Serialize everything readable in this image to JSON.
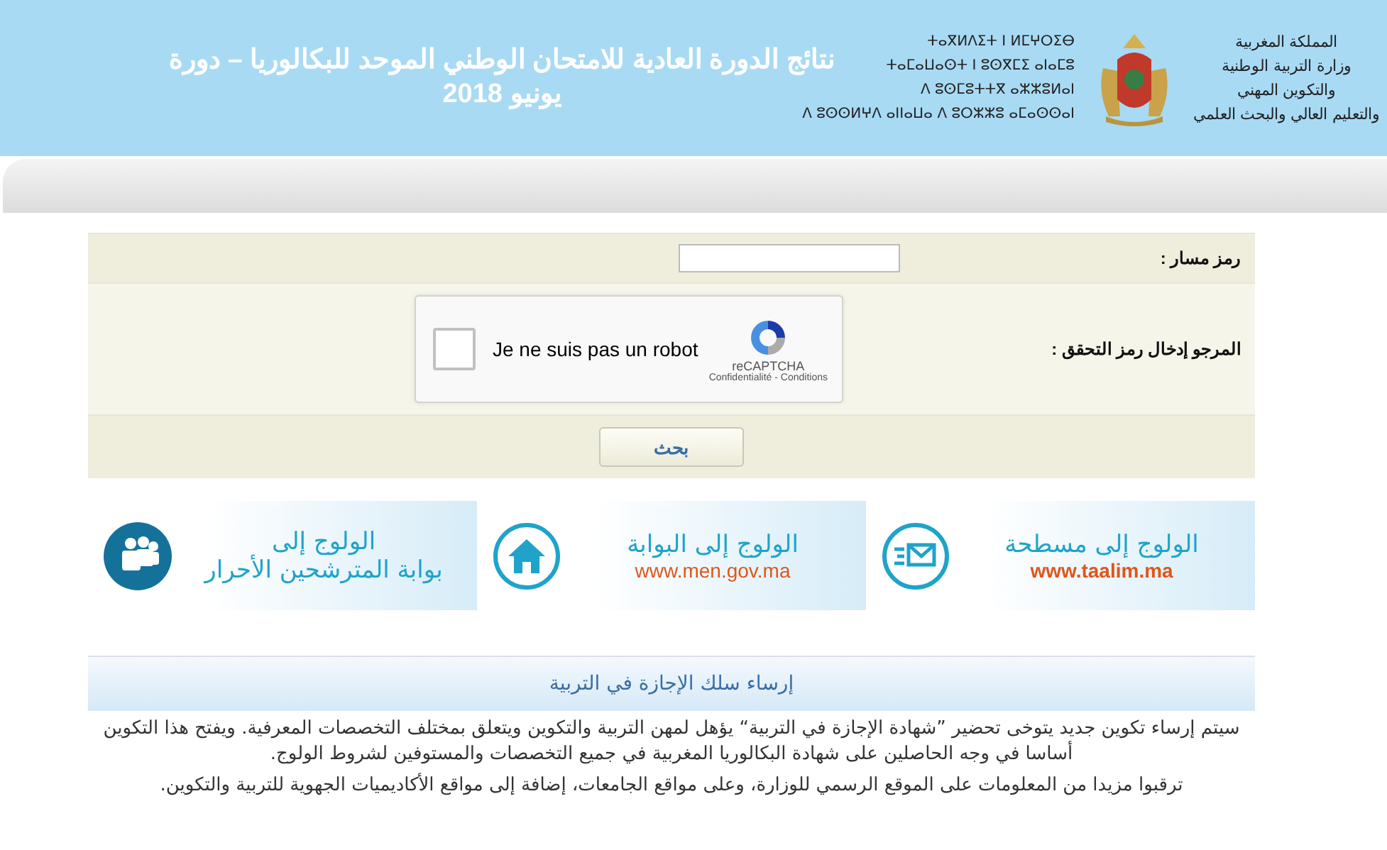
{
  "header": {
    "title_lines": [
      "نتائج الدورة العادية للامتحان الوطني الموحد للبكالوريا – دورة",
      "يونيو 2018"
    ],
    "ministry_arabic": [
      "المملكة المغربية",
      "وزارة التربية الوطنية",
      "والتكوين المهني",
      "والتعليم العالي والبحث العلمي"
    ],
    "ministry_tifinagh": [
      "ⵜⴰⴳⵍⴷⵉⵜ ⵏ ⵍⵎⵖⵔⵉⴱ",
      "ⵜⴰⵎⴰⵡⴰⵙⵜ ⵏ ⵓⵙⴳⵎⵉ ⴰⵏⴰⵎⵓ",
      "ⴷ ⵓⵙⵎⵓⵜⵜⴳ ⴰⵣⵣⵓⵍⴰⵏ",
      "ⴷ ⵓⵙⵙⵍⵖⴷ ⴰⵏⵏⴰⵡⴰ ⴷ ⵓⵔⵣⵣⵓ ⴰⵎⴰⵙⵙⴰⵏ"
    ]
  },
  "form": {
    "massar_label": "رمز مسار :",
    "captcha_label": "المرجو إدخال رمز التحقق :",
    "captcha": {
      "checked": false,
      "text": "Je ne suis pas un robot",
      "brand": "reCAPTCHA",
      "links": "Confidentialité - Conditions"
    },
    "submit": "بحث"
  },
  "banners": [
    {
      "kind": "taalim",
      "title": "الولوج إلى مسطحة",
      "url": "www.taalim.ma"
    },
    {
      "kind": "portal",
      "title": "الولوج إلى البوابة",
      "url": "www.men.gov.ma"
    },
    {
      "kind": "free",
      "title": "الولوج إلى",
      "url": "بوابة المترشحين الأحرار"
    }
  ],
  "news": {
    "title": "إرساء سلك الإجازة في التربية",
    "paragraphs": [
      "سيتم إرساء تكوين جديد يتوخى تحضير ”شهادة الإجازة في التربية“ يؤهل لمهن التربية والتكوين ويتعلق بمختلف التخصصات المعرفية. ويفتح هذا التكوين أساسا في وجه الحاصلين على شهادة البكالوريا المغربية في جميع التخصصات والمستوفين لشروط الولوج.",
      "ترقبوا مزيدا من المعلومات على الموقع الرسمي للوزارة، وعلى مواقع الجامعات، إضافة إلى مواقع الأكاديميات الجهوية للتربية والتكوين."
    ]
  }
}
